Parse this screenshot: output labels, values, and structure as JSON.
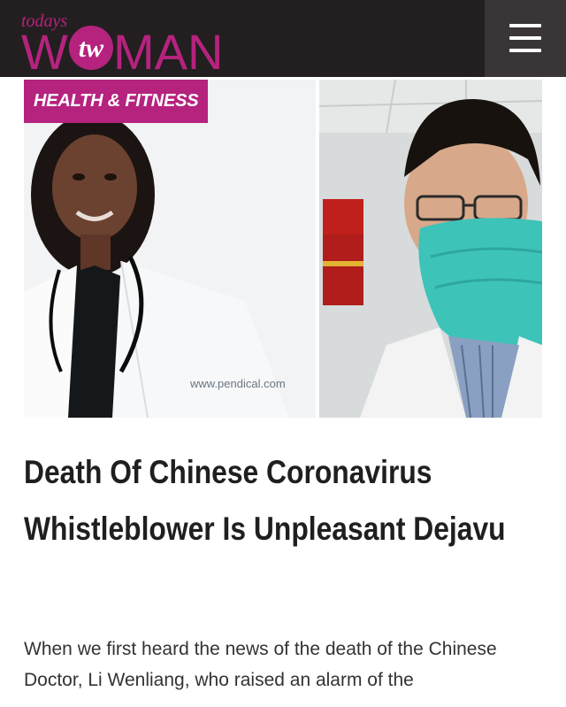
{
  "header": {
    "logo": {
      "prefix": "todays",
      "monogram": "tw",
      "wordmark_start": "W",
      "wordmark_end": "MAN"
    },
    "menu_icon": "hamburger-icon",
    "colors": {
      "background": "#231f20",
      "brand": "#b5237e",
      "menu_background": "#3a3637"
    }
  },
  "article": {
    "category": "HEALTH & FITNESS",
    "image_watermark": "www.pendical.com",
    "title": "Death Of Chinese Coronavirus Whistleblower Is Unpleasant Dejavu",
    "excerpt": "When we first heard the news of the death of the Chinese Doctor, Li Wenliang, who raised an alarm of the"
  }
}
